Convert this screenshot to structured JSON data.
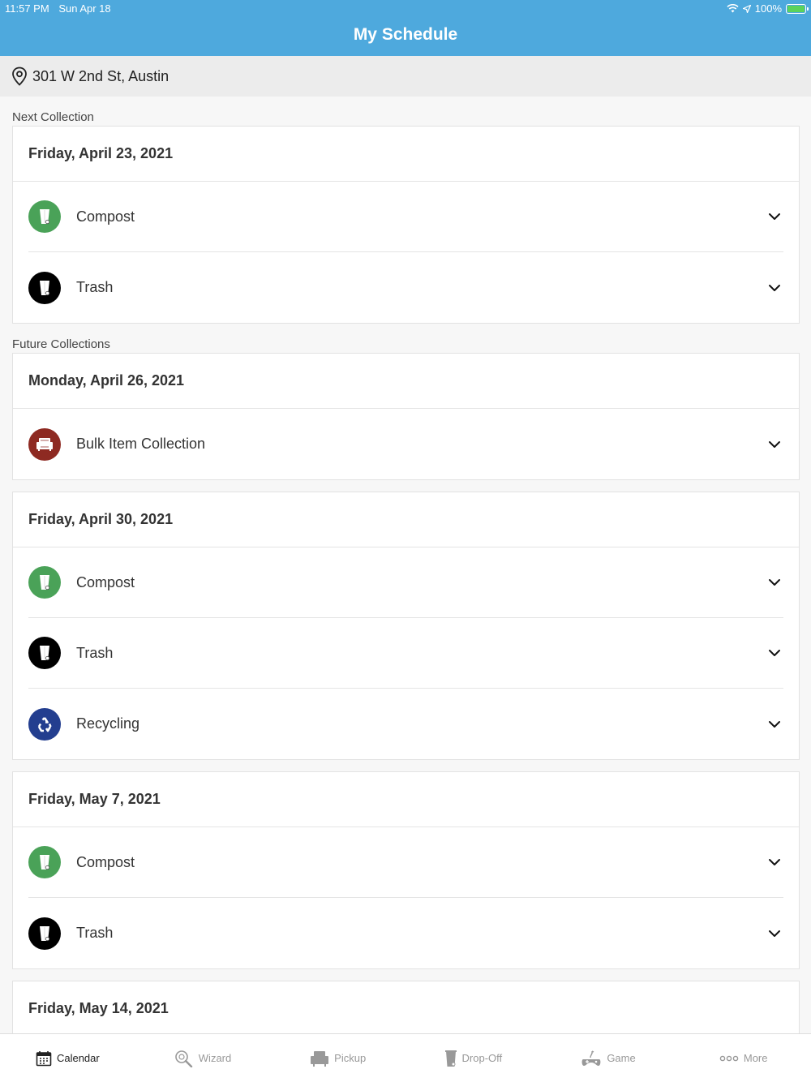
{
  "status_bar": {
    "time": "11:57 PM",
    "date": "Sun Apr 18",
    "battery": "100%",
    "icons": [
      "wifi-icon",
      "location-arrow-icon",
      "battery-charging-icon"
    ]
  },
  "header": {
    "title": "My Schedule"
  },
  "address": {
    "text": "301 W 2nd St, Austin",
    "icon": "map-pin-icon"
  },
  "colors": {
    "brand": "#4ea9dd",
    "compost": "#4aa258",
    "trash": "#000000",
    "bulk": "#8e2a22",
    "recycling": "#233e8f"
  },
  "sections": {
    "next_label": "Next Collection",
    "future_label": "Future Collections"
  },
  "collections": [
    {
      "date": "Friday, April 23, 2021",
      "items": [
        {
          "label": "Compost",
          "type": "compost"
        },
        {
          "label": "Trash",
          "type": "trash"
        }
      ]
    },
    {
      "date": "Monday, April 26, 2021",
      "items": [
        {
          "label": "Bulk Item Collection",
          "type": "bulk"
        }
      ]
    },
    {
      "date": "Friday, April 30, 2021",
      "items": [
        {
          "label": "Compost",
          "type": "compost"
        },
        {
          "label": "Trash",
          "type": "trash"
        },
        {
          "label": "Recycling",
          "type": "recycling"
        }
      ]
    },
    {
      "date": "Friday, May 7, 2021",
      "items": [
        {
          "label": "Compost",
          "type": "compost"
        },
        {
          "label": "Trash",
          "type": "trash"
        }
      ]
    },
    {
      "date": "Friday, May 14, 2021",
      "items": []
    }
  ],
  "tabs": [
    {
      "label": "Calendar",
      "icon": "calendar-icon",
      "active": true
    },
    {
      "label": "Wizard",
      "icon": "wizard-search-icon",
      "active": false
    },
    {
      "label": "Pickup",
      "icon": "pickup-couch-icon",
      "active": false
    },
    {
      "label": "Drop-Off",
      "icon": "dropoff-bin-icon",
      "active": false
    },
    {
      "label": "Game",
      "icon": "game-controller-icon",
      "active": false
    },
    {
      "label": "More",
      "icon": "more-dots-icon",
      "active": false
    }
  ]
}
